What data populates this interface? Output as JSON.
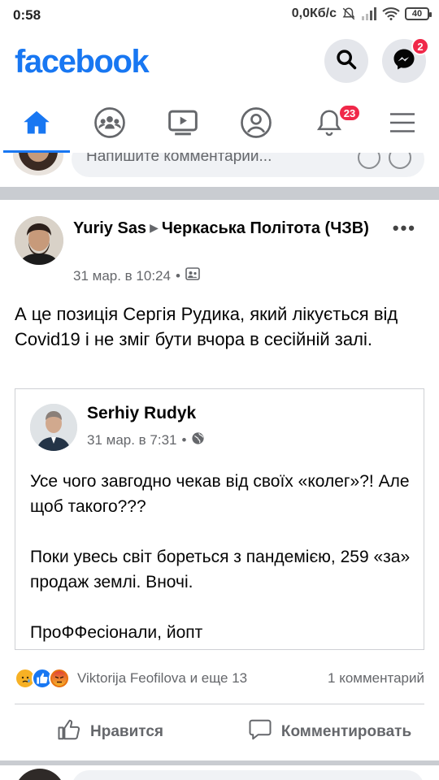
{
  "status_bar": {
    "time": "0:58",
    "network_speed": "0,0Кб/с",
    "battery": "40"
  },
  "header": {
    "logo": "facebook",
    "brand_color": "#1877f2",
    "messenger_badge": "2"
  },
  "nav": {
    "notifications_badge": "23",
    "tabs": [
      "home-icon",
      "groups-icon",
      "watch-icon",
      "profile-icon",
      "notifications-icon",
      "menu-icon"
    ]
  },
  "previous_comment": {
    "placeholder": "Напишите комментарий..."
  },
  "post": {
    "author": "Yuriy Sas",
    "group": "Черкаська Політота (ЧЗВ)",
    "timestamp": "31 мар. в 10:24",
    "text": "А це позиція Сергія Рудика, який лікується від Covid19 і не зміг бути вчора в сесійній залі.",
    "shared": {
      "author": "Serhiy Rudyk",
      "timestamp": "31 мар. в 7:31",
      "paragraphs": [
        "Усе чого завгодно чекав від своїх «колег»?! Але щоб такого???",
        "Поки увесь світ бореться з пандемією, 259 «за» продаж землі. Вночі.",
        "ПроФФесіонали, йопт"
      ]
    },
    "reactions_text": "Viktorija Feofilova и еще 13",
    "comments_count": "1 комментарий",
    "like_label": "Нравится",
    "comment_label": "Комментировать"
  }
}
